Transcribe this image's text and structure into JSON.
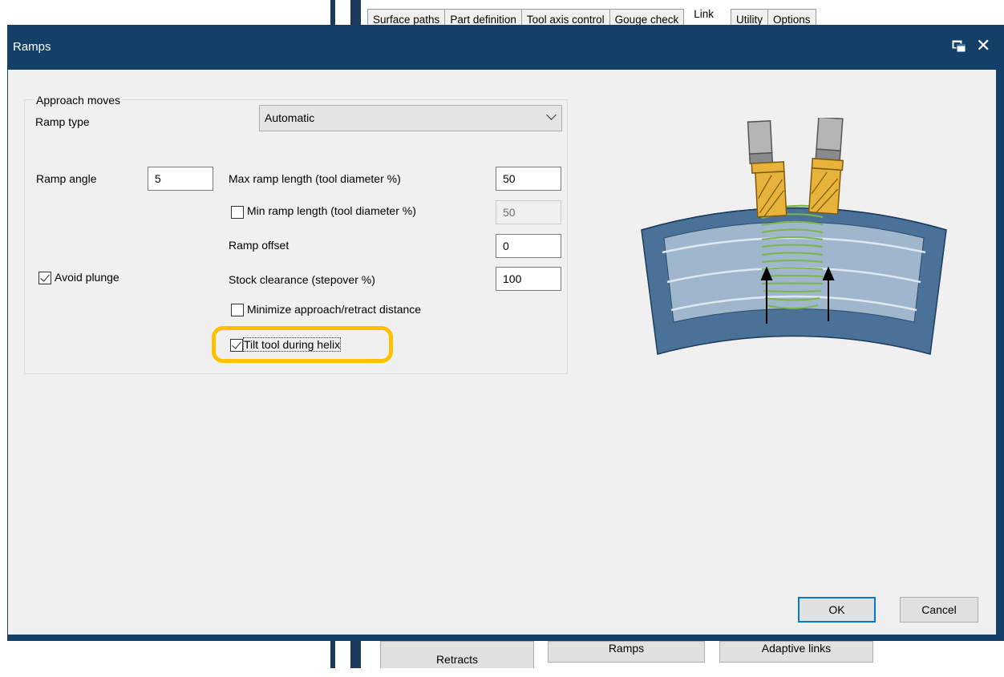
{
  "background": {
    "tabs": [
      "Surface paths",
      "Part definition",
      "Tool axis control",
      "Gouge check",
      "Link",
      "Utility",
      "Options"
    ],
    "bottom_buttons": [
      "Retracts",
      "Ramps",
      "Adaptive links"
    ]
  },
  "dialog": {
    "title": "Ramps",
    "group_title": "Approach moves",
    "ramp_type": {
      "label": "Ramp type",
      "value": "Automatic"
    },
    "ramp_angle": {
      "label": "Ramp angle",
      "value": "5"
    },
    "max_ramp_length": {
      "label": "Max ramp length (tool diameter %)",
      "value": "50"
    },
    "min_ramp_length": {
      "label": "Min ramp length (tool diameter %)",
      "value": "50",
      "checked": false
    },
    "ramp_offset": {
      "label": "Ramp offset",
      "value": "0"
    },
    "avoid_plunge": {
      "label": "Avoid plunge",
      "checked": true
    },
    "stock_clearance": {
      "label": "Stock clearance (stepover %)",
      "value": "100"
    },
    "minimize_distance": {
      "label": "Minimize approach/retract distance",
      "checked": false
    },
    "tilt_tool": {
      "label": "Tilt tool during helix",
      "checked": true
    },
    "ok_label": "OK",
    "cancel_label": "Cancel"
  },
  "colors": {
    "titlebar": "#143f66",
    "highlight": "#ffc000",
    "tool_yellow": "#e8b33a",
    "helix_green": "#7ab648",
    "part_blue": "#4a7298"
  }
}
